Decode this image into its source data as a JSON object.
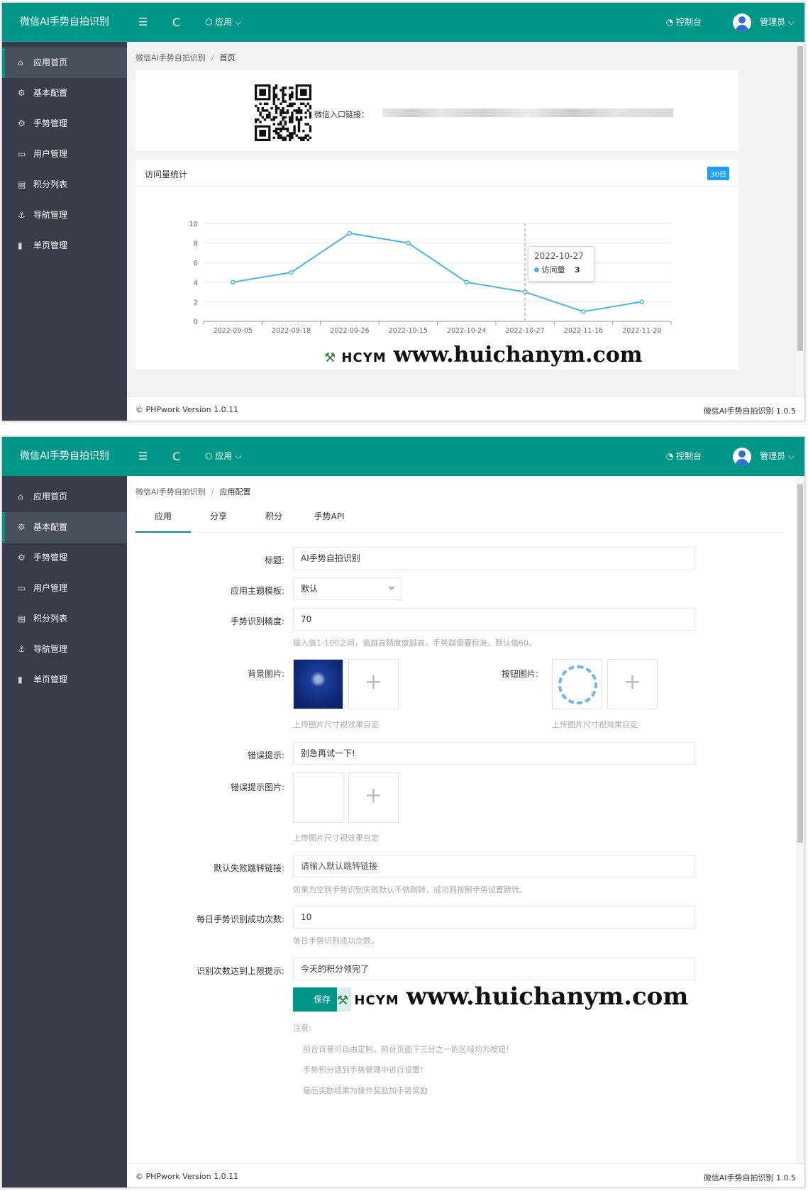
{
  "app": {
    "logo": "微信AI手势自拍识别",
    "menu_icon": "☰",
    "refresh_icon": "C",
    "app_menu": "应用",
    "console": "控制台",
    "admin": "管理员",
    "accent": "#009688",
    "sidebar_bg": "#393d49"
  },
  "sidebar": {
    "items": [
      {
        "label": "应用首页",
        "icon": "home-icon"
      },
      {
        "label": "基本配置",
        "icon": "gear-icon"
      },
      {
        "label": "手势管理",
        "icon": "gear-icon"
      },
      {
        "label": "用户管理",
        "icon": "user-card-icon"
      },
      {
        "label": "积分列表",
        "icon": "list-icon"
      },
      {
        "label": "导航管理",
        "icon": "anchor-icon"
      },
      {
        "label": "单页管理",
        "icon": "file-icon"
      }
    ]
  },
  "dashboard": {
    "breadcrumb": {
      "root": "微信AI手势自拍识别",
      "sep": "/",
      "current": "首页"
    },
    "entry_label": "微信入口链接：",
    "chart_title": "访问量统计",
    "range_badge": "30日",
    "tooltip": {
      "date": "2022-10-27",
      "series": "访问量",
      "value": "3"
    }
  },
  "chart_data": {
    "type": "line",
    "categories": [
      "2022-09-05",
      "2022-09-18",
      "2022-09-26",
      "2022-10-15",
      "2022-10-24",
      "2022-10-27",
      "2022-11-16",
      "2022-11-20"
    ],
    "series": [
      {
        "name": "访问量",
        "values": [
          4,
          5,
          9,
          8,
          4,
          3,
          1,
          2
        ],
        "color": "#4ab4e6"
      }
    ],
    "yticks": [
      0,
      2,
      4,
      6,
      8,
      10
    ],
    "ylim": [
      0,
      10
    ],
    "grid": true
  },
  "watermark": {
    "logo": "HCYM",
    "url": "www.huichanym.com"
  },
  "footer": {
    "left": "© PHPwork Version 1.0.11",
    "right": "微信AI手势自拍识别 1.0.5"
  },
  "config": {
    "breadcrumb": {
      "root": "微信AI手势自拍识别",
      "sep": "/",
      "current": "应用配置"
    },
    "tabs": [
      "应用",
      "分享",
      "积分",
      "手势API"
    ],
    "fields": {
      "title_label": "标题:",
      "title_value": "AI手势自拍识别",
      "theme_label": "应用主题模板:",
      "theme_value": "默认",
      "precision_label": "手势识别精度:",
      "precision_value": "70",
      "precision_hint": "输入值1-100之间，值越高精度度越高，手势越需要标准，默认值60。",
      "bg_label": "背景图片:",
      "btn_label": "按钮图片:",
      "upload_hint": "上传图片尺寸视效果自定",
      "error_label": "错误提示:",
      "error_value": "别急再试一下!",
      "error_img_label": "错误提示图片:",
      "fail_link_label": "默认失败跳转链接:",
      "fail_link_placeholder": "请输入默认跳转链接",
      "fail_link_hint": "如果为空则手势识别失败默认不做跳转，成功则按照手势设置跳转。",
      "daily_label": "每日手势识别成功次数:",
      "daily_value": "10",
      "daily_hint": "每日手势识别成功次数。",
      "limit_label": "识别次数达到上限提示:",
      "limit_value": "今天的积分领完了",
      "save": "保存",
      "note_label": "注意:",
      "notes": [
        "前台背景可自由定制，前台页面下三分之一的区域均为按钮！",
        "手势积分请到手势管理中进行设置！",
        "最后奖励结果为操作奖励加手势奖励"
      ]
    }
  }
}
